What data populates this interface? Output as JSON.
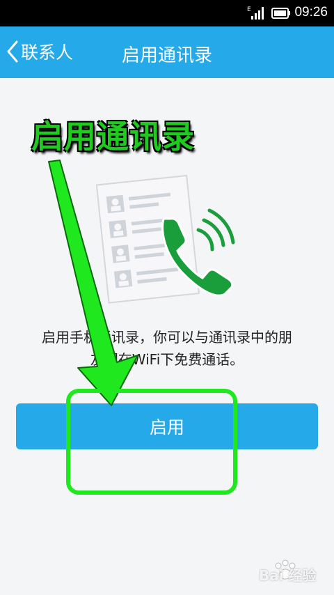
{
  "status_bar": {
    "time": "09:26",
    "network_type": "E",
    "icons": [
      "signal-icon",
      "battery-icon"
    ]
  },
  "title_bar": {
    "back_label": "联系人",
    "title": "启用通讯录",
    "back_icon": "chevron-left-icon"
  },
  "annotation": {
    "overlay_title": "启用通讯录",
    "arrow_color": "#1fe81f",
    "box_color": "#1fe81f"
  },
  "content": {
    "description_line1": "启用手机通讯录，你可以与通讯录中的朋",
    "description_line2": "友们在WiFi下免费通话。",
    "enable_button_label": "启用"
  },
  "watermark": {
    "text": "Bai 经验"
  },
  "colors": {
    "accent": "#26a9e8",
    "background": "#f4f5f7",
    "phone_green": "#1a9e3c"
  }
}
